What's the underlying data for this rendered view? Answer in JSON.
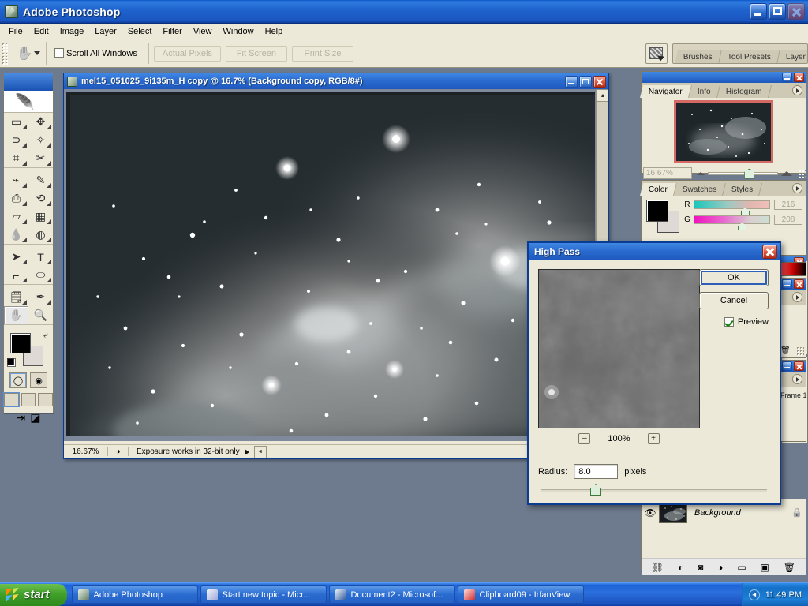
{
  "app": {
    "title": "Adobe Photoshop",
    "logo_icon": "photoshop-feather-icon",
    "window_buttons": {
      "minimize": "minimize-icon",
      "maximize": "maximize-icon",
      "close": "close-icon"
    }
  },
  "menubar": {
    "items": [
      "File",
      "Edit",
      "Image",
      "Layer",
      "Select",
      "Filter",
      "View",
      "Window",
      "Help"
    ]
  },
  "options_bar": {
    "tool_icon": "hand-tool-icon",
    "tool_preset_caret": "chevron-down-icon",
    "scroll_all_windows_label": "Scroll All Windows",
    "scroll_all_windows_checked": false,
    "buttons": [
      "Actual Pixels",
      "Fit Screen",
      "Print Size"
    ],
    "palette_well_icon": "palette-well-icon",
    "well_tabs": [
      "Brushes",
      "Tool Presets",
      "Layer Comps"
    ]
  },
  "toolbox": {
    "tools": [
      "rectangular-marquee-icon",
      "move-icon",
      "lasso-icon",
      "magic-wand-icon",
      "crop-icon",
      "slice-icon",
      "healing-brush-icon",
      "brush-icon",
      "clone-stamp-icon",
      "history-brush-icon",
      "eraser-icon",
      "gradient-icon",
      "blur-icon",
      "dodge-icon",
      "path-selection-icon",
      "type-icon",
      "pen-icon",
      "shape-icon",
      "notes-icon",
      "eyedropper-icon",
      "hand-icon",
      "zoom-icon"
    ],
    "selected_tool": "hand-icon",
    "foreground_color": "#000000",
    "background_color": "#ded9d4",
    "swap_colors_icon": "swap-colors-icon",
    "default_colors_icon": "default-colors-icon",
    "quick_mask_modes": [
      "standard-mask-mode-icon",
      "quick-mask-mode-icon"
    ],
    "screen_modes": [
      "standard-screen-mode-icon",
      "full-screen-menubar-icon",
      "full-screen-icon"
    ],
    "jump_to": [
      "jump-to-imageready-icon",
      "jump-icon"
    ]
  },
  "document": {
    "title": "mel15_051025_9i135m_H copy @ 16.7% (Background copy, RGB/8#)",
    "icon": "document-icon",
    "status_zoom": "16.67%",
    "status_message": "Exposure works in 32-bit only",
    "window_buttons": {
      "minimize": "minimize-icon",
      "maximize": "maximize-icon",
      "close": "close-icon"
    }
  },
  "navigator_palette": {
    "tabs": [
      "Navigator",
      "Info",
      "Histogram"
    ],
    "active_tab": "Navigator",
    "zoom_value": "16.67%",
    "menu_icon": "palette-menu-icon",
    "zoom_out_icon": "zoom-out-mountain-icon",
    "zoom_in_icon": "zoom-in-mountain-icon"
  },
  "color_palette": {
    "tabs": [
      "Color",
      "Swatches",
      "Styles"
    ],
    "active_tab": "Color",
    "menu_icon": "palette-menu-icon",
    "channels": [
      {
        "label": "R",
        "value": "216"
      },
      {
        "label": "G",
        "value": "208"
      }
    ],
    "foreground_color": "#000000",
    "background_color": "#ded9d4"
  },
  "layers_palette": {
    "rows": [
      {
        "name": "Background",
        "visible": true,
        "locked": true,
        "eye_icon": "eye-icon",
        "lock_icon": "lock-icon"
      }
    ],
    "footer_icons": [
      "link-layers-icon",
      "layer-style-icon",
      "layer-mask-icon",
      "adjustment-layer-icon",
      "new-group-icon",
      "new-layer-icon",
      "delete-layer-icon"
    ]
  },
  "animation_palette": {
    "frame_label": "Frame 1"
  },
  "dialog": {
    "title": "High Pass",
    "close_icon": "close-icon",
    "preview_zoom": "100%",
    "zoom_out_label": "–",
    "zoom_in_label": "+",
    "ok_label": "OK",
    "cancel_label": "Cancel",
    "preview_label": "Preview",
    "preview_checked": true,
    "radius_label": "Radius:",
    "radius_value": "8.0",
    "radius_units": "pixels"
  },
  "taskbar": {
    "start_label": "start",
    "start_icon": "windows-flag-icon",
    "items": [
      {
        "label": "Adobe Photoshop",
        "icon": "photoshop-icon",
        "color": "#1b6ea8"
      },
      {
        "label": "Start new topic - Micr...",
        "icon": "browser-icon",
        "color": "#e9e9f4"
      },
      {
        "label": "Document2 - Microsof...",
        "icon": "word-icon",
        "color": "#2a5699"
      },
      {
        "label": "Clipboard09 - IrfanView",
        "icon": "irfanview-icon",
        "color": "#cf2a2a"
      }
    ],
    "tray_arrow_icon": "tray-expand-icon",
    "clock": "11:49 PM"
  },
  "colors": {
    "xp_blue": "#1e58bd",
    "panel_bg": "#ece9d8",
    "desktop": "#6e7b8f",
    "navigator_frame": "#d46a63"
  }
}
